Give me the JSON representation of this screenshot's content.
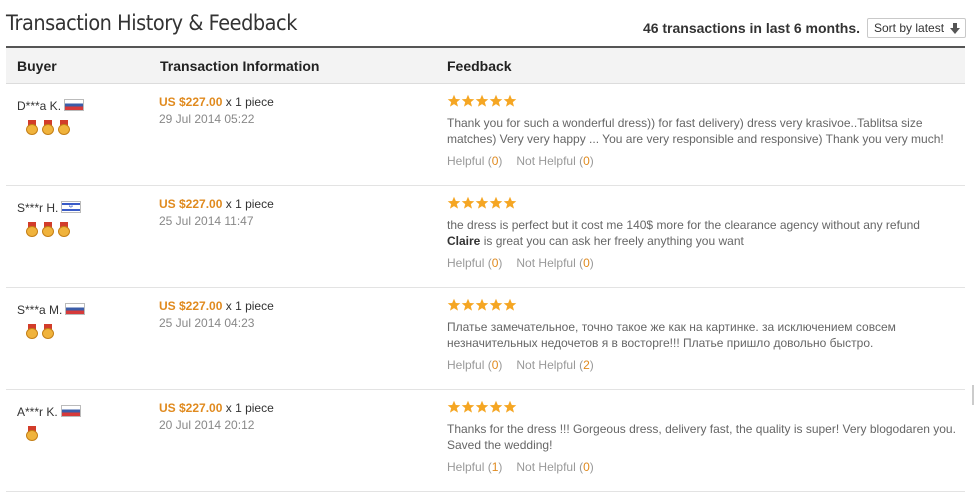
{
  "header": {
    "title": "Transaction History & Feedback",
    "summary": "46 transactions in last 6 months.",
    "sort_label": "Sort by latest"
  },
  "columns": {
    "buyer": "Buyer",
    "transaction": "Transaction Information",
    "feedback": "Feedback"
  },
  "labels": {
    "helpful": "Helpful",
    "not_helpful": "Not Helpful"
  },
  "rows": [
    {
      "buyer": "D***a K.",
      "flag": "russia-flag",
      "medals": 3,
      "price": "US $227.00",
      "qty": "x 1 piece",
      "date": "29 Jul 2014 05:22",
      "stars": 5,
      "comment": "Thank you for such a wonderful dress)) for fast delivery) dress very krasivoe..Tablitsa size matches) Very very happy ... You are very responsible and responsive) Thank you very much!",
      "comment_bold": "",
      "comment_after": "",
      "helpful": "0",
      "not_helpful": "0"
    },
    {
      "buyer": "S***r H.",
      "flag": "israel-flag",
      "medals": 3,
      "price": "US $227.00",
      "qty": "x 1 piece",
      "date": "25 Jul 2014 11:47",
      "stars": 5,
      "comment": "the dress is perfect but it cost me 140$ more for the clearance agency without any refund",
      "comment_bold": "Claire",
      "comment_after": " is great you can ask her freely anything you want",
      "helpful": "0",
      "not_helpful": "0"
    },
    {
      "buyer": "S***a M.",
      "flag": "russia-flag",
      "medals": 2,
      "price": "US $227.00",
      "qty": "x 1 piece",
      "date": "25 Jul 2014 04:23",
      "stars": 5,
      "comment": "Платье замечательное, точно такое же как на картинке. за исключением совсем незначительных недочетов я в восторге!!! Платье пришло довольно быстро.",
      "comment_bold": "",
      "comment_after": "",
      "helpful": "0",
      "not_helpful": "2"
    },
    {
      "buyer": "A***r K.",
      "flag": "russia-flag",
      "medals": 1,
      "price": "US $227.00",
      "qty": "x 1 piece",
      "date": "20 Jul 2014 20:12",
      "stars": 5,
      "comment": "Thanks for the dress !!! Gorgeous dress, delivery fast, the quality is super! Very blogodaren you. Saved the wedding!",
      "comment_bold": "",
      "comment_after": "",
      "helpful": "1",
      "not_helpful": "0"
    }
  ],
  "colors": {
    "price": "#e08a1e",
    "star": "#f5a623",
    "header_rule": "#555555"
  }
}
